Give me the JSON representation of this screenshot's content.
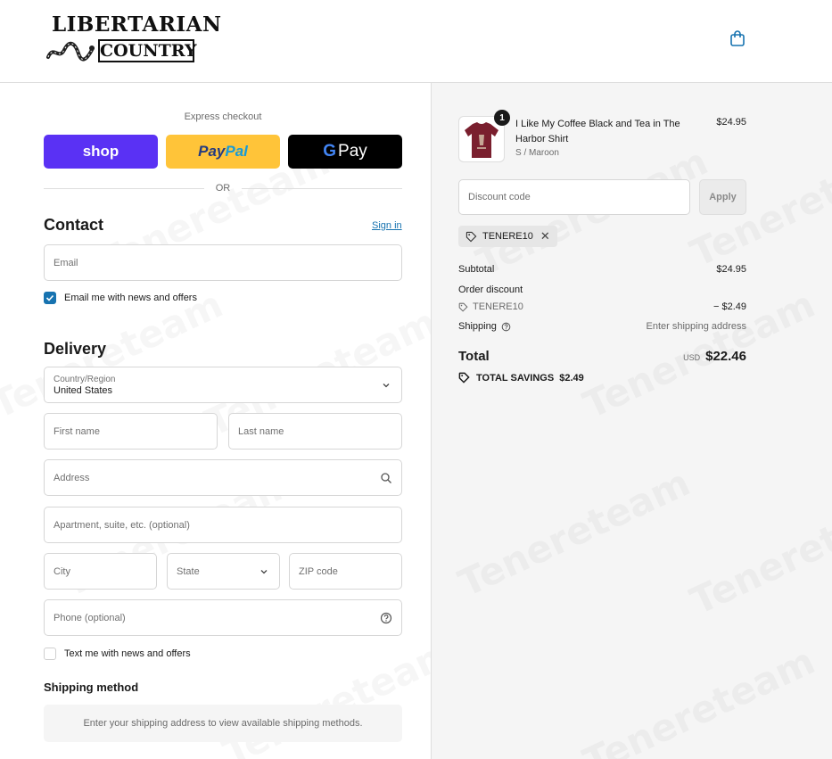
{
  "brand": {
    "logo_top": "LIBERTARIAN",
    "logo_bottom": "COUNTRY"
  },
  "watermark": "Tenereteam",
  "express": {
    "label": "Express checkout",
    "shop_label": "shop",
    "paypal_a": "Pay",
    "paypal_b": "Pal",
    "gpay_g": "G",
    "gpay_label": "Pay",
    "or_label": "OR"
  },
  "contact": {
    "title": "Contact",
    "sign_in": "Sign in",
    "email_placeholder": "Email",
    "news_checkbox_label": "Email me with news and offers",
    "news_checked": true
  },
  "delivery": {
    "title": "Delivery",
    "country_label": "Country/Region",
    "country_value": "United States",
    "first_name": "First name",
    "last_name": "Last name",
    "address": "Address",
    "apartment": "Apartment, suite, etc. (optional)",
    "city": "City",
    "state": "State",
    "zip": "ZIP code",
    "phone": "Phone (optional)",
    "text_checkbox_label": "Text me with news and offers",
    "text_checked": false
  },
  "shipping_method": {
    "title": "Shipping method",
    "message": "Enter your shipping address to view available shipping methods."
  },
  "order": {
    "item": {
      "name": "I Like My Coffee Black and Tea in The Harbor Shirt",
      "variant": "S / Maroon",
      "price": "$24.95",
      "quantity": "1"
    },
    "discount_placeholder": "Discount code",
    "apply_label": "Apply",
    "applied_code": "TENERE10",
    "subtotal_label": "Subtotal",
    "subtotal_value": "$24.95",
    "order_discount_label": "Order discount",
    "discount_code": "TENERE10",
    "discount_value": "− $2.49",
    "shipping_label": "Shipping",
    "shipping_value": "Enter shipping address",
    "total_label": "Total",
    "currency": "USD",
    "total_value": "$22.46",
    "savings_label": "TOTAL SAVINGS",
    "savings_value": "$2.49"
  },
  "colors": {
    "shop": "#5a31f4",
    "paypal": "#ffc439",
    "gpay": "#000000",
    "link": "#1773b0",
    "summary_bg": "#f5f5f5"
  }
}
